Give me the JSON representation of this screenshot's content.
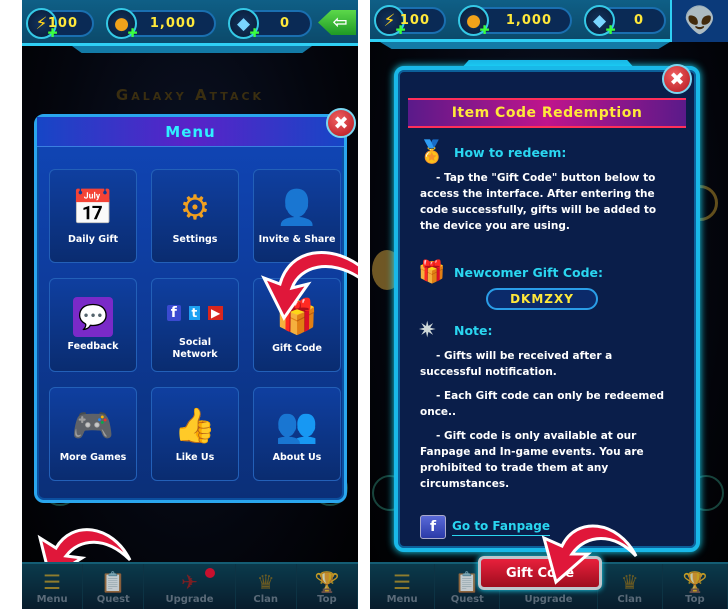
{
  "resources": {
    "energy": {
      "icon": "lightning-icon",
      "value": "100"
    },
    "coins": {
      "icon": "coin-icon",
      "value": "1,000"
    },
    "crystals": {
      "icon": "crystal-icon",
      "value": "0"
    }
  },
  "background_title": "Galaxy Attack",
  "left_screen": {
    "menu_dialog": {
      "title": "Menu",
      "items": [
        {
          "label": "Daily Gift",
          "icon": "calendar-gift-icon"
        },
        {
          "label": "Settings",
          "icon": "gear-icon"
        },
        {
          "label": "Invite & Share",
          "icon": "invite-user-icon"
        },
        {
          "label": "Feedback",
          "icon": "chat-bubbles-icon"
        },
        {
          "label": "Social Network",
          "icon": "social-network-icon"
        },
        {
          "label": "Gift Code",
          "icon": "gift-box-icon"
        },
        {
          "label": "More Games",
          "icon": "gamepad-icon"
        },
        {
          "label": "Like Us",
          "icon": "thumbs-up-icon"
        },
        {
          "label": "About Us",
          "icon": "group-icon"
        }
      ]
    }
  },
  "bottom_nav": [
    {
      "label": "Menu",
      "icon": "hamburger-icon"
    },
    {
      "label": "Quest",
      "icon": "clipboard-check-icon"
    },
    {
      "label": "Upgrade",
      "icon": "spaceship-icon"
    },
    {
      "label": "Clan",
      "icon": "clan-crown-icon"
    },
    {
      "label": "Top",
      "icon": "trophy-icon"
    }
  ],
  "right_screen": {
    "redeem_dialog": {
      "title": "Item Code Redemption",
      "how_to_heading": "How to redeem:",
      "how_to_text": "- Tap the \"Gift Code\" button below to access the interface. After entering the code successfully, gifts will be added to the device you are using.",
      "newcomer_heading": "Newcomer Gift Code:",
      "newcomer_code": "DKMZXY",
      "note_heading": "Note:",
      "notes": [
        "- Gifts will be received after a successful notification.",
        "- Each Gift code can only be redeemed once..",
        "- Gift code is only available at our Fanpage and In-game events. You are prohibited to trade them at any circumstances."
      ],
      "fanpage_link": "Go to Fanpage",
      "gift_code_button": "Gift Code"
    }
  },
  "colors": {
    "accent_cyan": "#2ad6f0",
    "resource_yellow": "#ffe83a",
    "arrow_red": "#e0173a",
    "dialog_blue": "#1046b8"
  }
}
